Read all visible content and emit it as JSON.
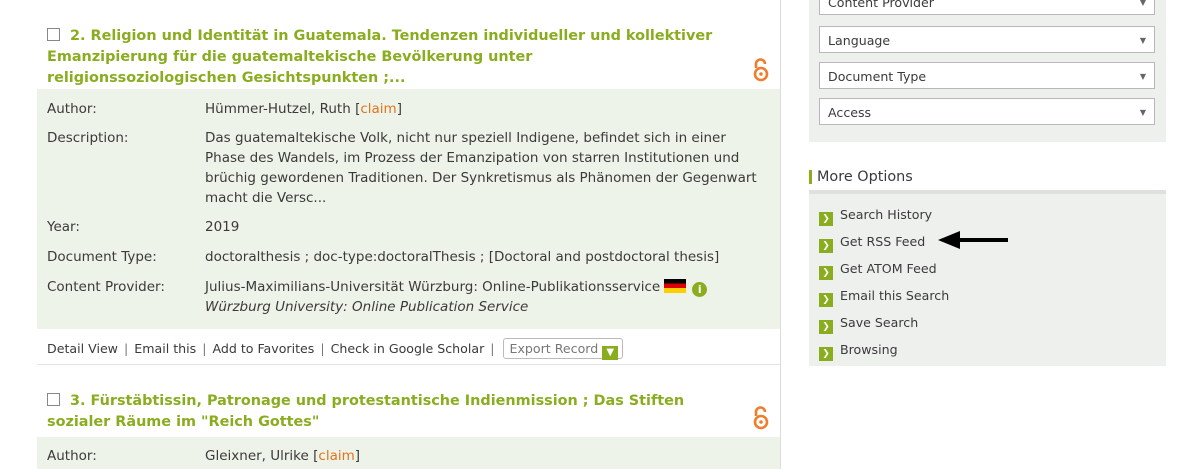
{
  "results": [
    {
      "number_title": "2. Religion und Identität in Guatemala. Tendenzen individueller und kollektiver Emanzipierung für die guatemaltekische Bevölkerung unter religionssoziologischen Gesichtspunkten ;...",
      "author_label": "Author:",
      "author": "Hümmer-Hutzel, Ruth",
      "claim_open": "[",
      "claim": "claim",
      "claim_close": "]",
      "description_label": "Description:",
      "description": "Das guatemaltekische Volk, nicht nur speziell Indigene, befindet sich in einer Phase des Wandels, im Prozess der Emanzipation von starren Institutionen und brüchig gewordenen Traditionen. Der Synkretismus als Phänomen der Gegenwart macht die Versc...",
      "year_label": "Year:",
      "year": "2019",
      "doctype_label": "Document Type:",
      "doctype": "doctoralthesis ; doc-type:doctoralThesis ; [Doctoral and postdoctoral thesis]",
      "provider_label": "Content Provider:",
      "provider": "Julius-Maximilians-Universität Würzburg: Online-Publikationsservice",
      "provider_en": "Würzburg University: Online Publication Service"
    },
    {
      "number_title": "3. Fürstäbtissin, Patronage und protestantische Indienmission ; Das Stiften sozialer Räume im \"Reich Gottes\"",
      "author_label": "Author:",
      "author": "Gleixner, Ulrike",
      "claim_open": "[",
      "claim": "claim",
      "claim_close": "]"
    }
  ],
  "actions": {
    "detail_view": "Detail View",
    "email_this": "Email this",
    "add_favorites": "Add to Favorites",
    "google_scholar": "Check in Google Scholar",
    "export_record": "Export Record",
    "separator": "|"
  },
  "facets": [
    {
      "label": "Content Provider"
    },
    {
      "label": "Language"
    },
    {
      "label": "Document Type"
    },
    {
      "label": "Access"
    }
  ],
  "more_options": {
    "title": "More Options",
    "items": [
      "Search History",
      "Get RSS Feed",
      "Get ATOM Feed",
      "Email this Search",
      "Save Search",
      "Browsing"
    ]
  },
  "colors": {
    "accent_green": "#8aad1f",
    "claim_orange": "#e2731b",
    "oa_orange": "#ef7d2b",
    "detail_bg": "#eef3ea"
  },
  "icons": {
    "open_access": "open-access-lock-icon",
    "country_flag": "germany-flag-icon",
    "provider_info": "info-icon",
    "dropdown": "caret-down-icon",
    "option_bullet": "chevron-right-icon",
    "annotation": "black-arrow-icon"
  }
}
